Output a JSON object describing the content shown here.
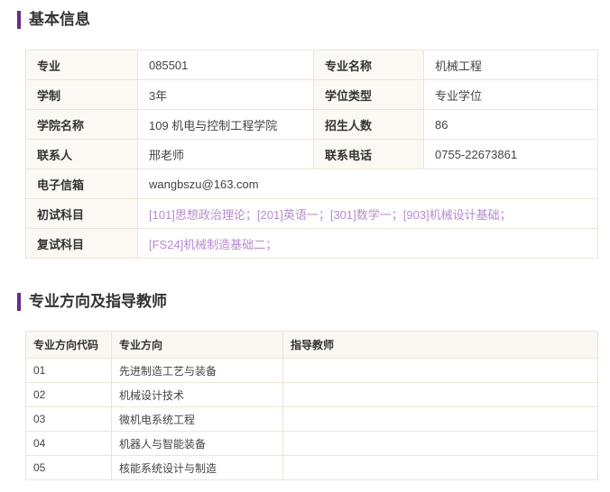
{
  "sections": {
    "basic_info_title": "基本信息",
    "directions_title": "专业方向及指导教师"
  },
  "info": {
    "major_label": "专业",
    "major_value": "085501",
    "major_name_label": "专业名称",
    "major_name_value": "机械工程",
    "duration_label": "学制",
    "duration_value": "3年",
    "degree_type_label": "学位类型",
    "degree_type_value": "专业学位",
    "college_label": "学院名称",
    "college_value": "109 机电与控制工程学院",
    "enrollment_label": "招生人数",
    "enrollment_value": "86",
    "contact_label": "联系人",
    "contact_value": "邢老师",
    "phone_label": "联系电话",
    "phone_value": "0755-22673861",
    "email_label": "电子信箱",
    "email_value": "wangbszu@163.com",
    "prelim_label": "初试科目",
    "prelim_value": "[101]思想政治理论；[201]英语一；[301]数学一；[903]机械设计基础；",
    "retest_label": "复试科目",
    "retest_value": "[FS24]机械制造基础二；"
  },
  "directions": {
    "headers": [
      "专业方向代码",
      "专业方向",
      "指导教师"
    ],
    "rows": [
      {
        "code": "01",
        "name": "先进制造工艺与装备",
        "advisor": ""
      },
      {
        "code": "02",
        "name": "机械设计技术",
        "advisor": ""
      },
      {
        "code": "03",
        "name": "微机电系统工程",
        "advisor": ""
      },
      {
        "code": "04",
        "name": "机器人与智能装备",
        "advisor": ""
      },
      {
        "code": "05",
        "name": "核能系统设计与制造",
        "advisor": ""
      }
    ]
  },
  "colors": {
    "accent": "#6b2a8a",
    "link": "#b68ad0",
    "border": "#ece4d8",
    "label_bg": "#fcf9f5"
  }
}
